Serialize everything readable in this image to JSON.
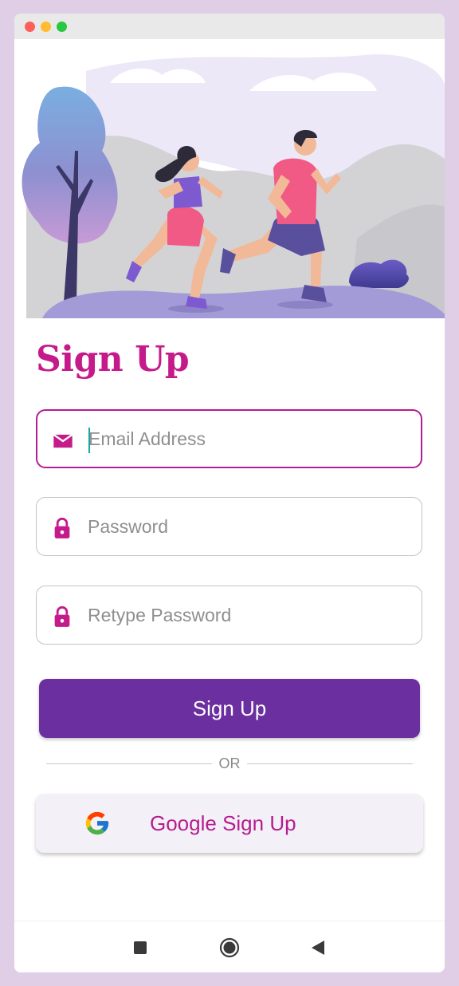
{
  "window": {
    "controls": [
      "close",
      "minimize",
      "maximize"
    ]
  },
  "hero": {
    "illustration": "couple-jogging-illustration"
  },
  "form": {
    "title": "Sign Up",
    "email": {
      "placeholder": "Email Address",
      "icon": "mail-icon",
      "value": ""
    },
    "password": {
      "placeholder": "Password",
      "icon": "lock-icon",
      "value": ""
    },
    "retype_password": {
      "placeholder": "Retype Password",
      "icon": "lock-icon",
      "value": ""
    },
    "submit_label": "Sign Up",
    "divider_text": "OR",
    "google_label": "Google Sign Up"
  },
  "colors": {
    "accent": "#c51a8a",
    "primary_button": "#6b2fa0",
    "focus_border": "#b41f8f",
    "background": "#e0cde6"
  },
  "nav": {
    "buttons": [
      "recents-icon",
      "home-icon",
      "back-icon"
    ]
  }
}
